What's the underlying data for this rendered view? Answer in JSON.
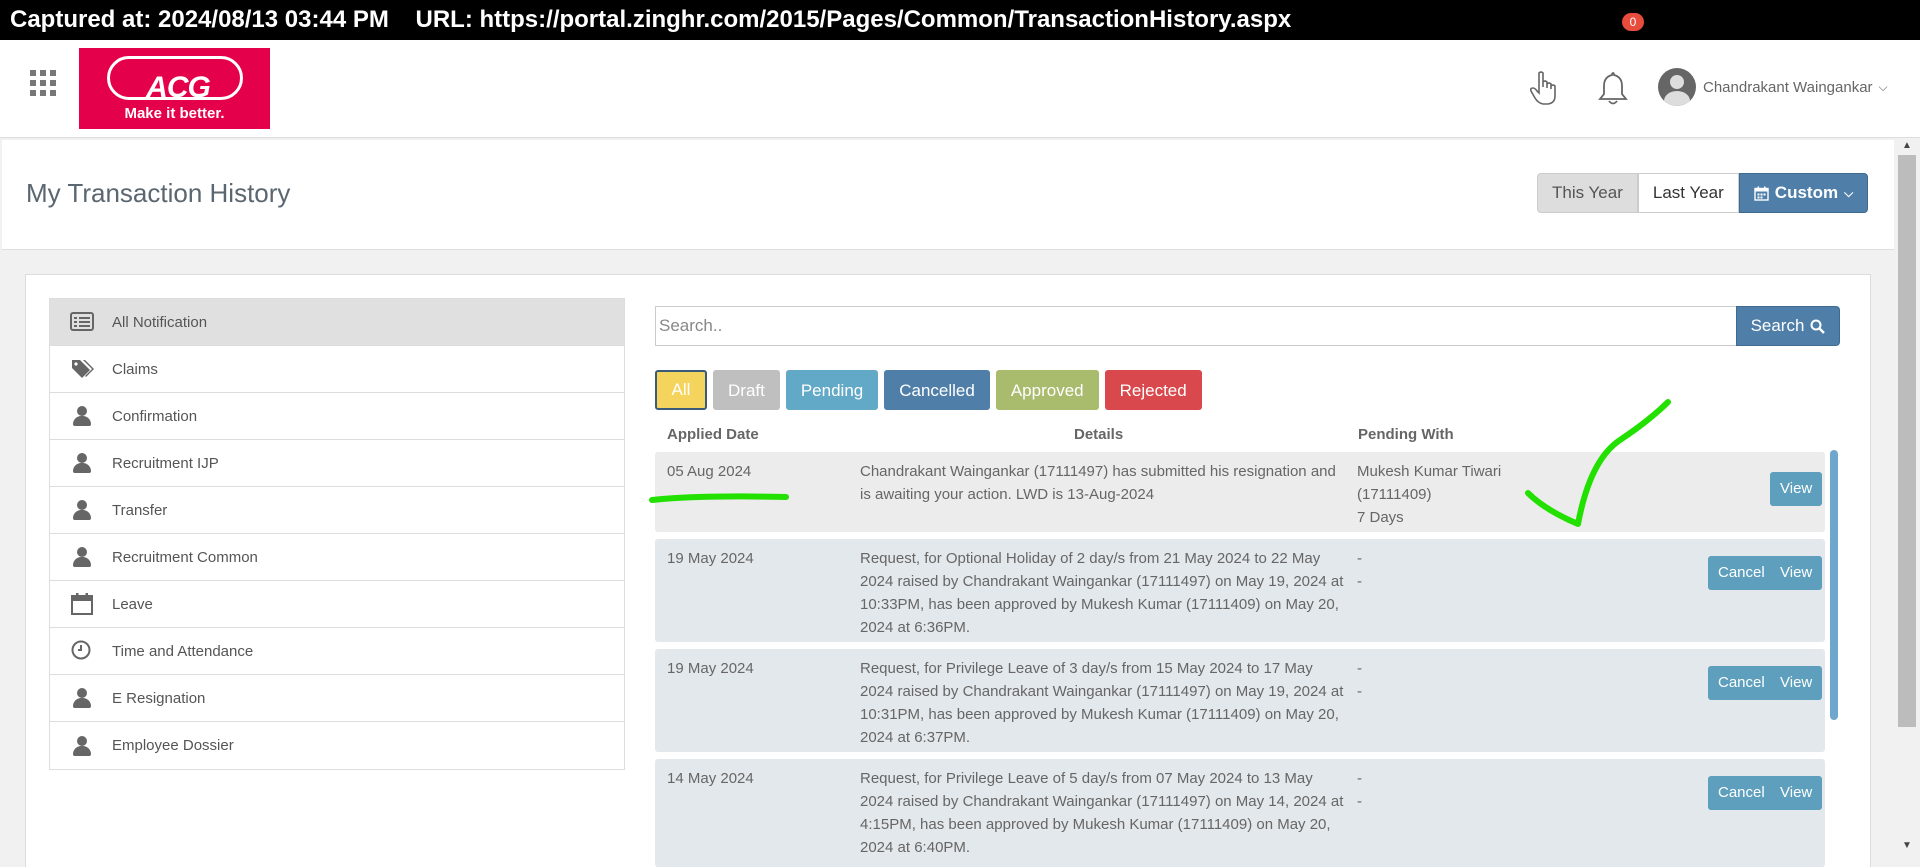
{
  "capture": {
    "text": "Captured at: 2024/08/13 03:44 PM    URL: https://portal.zinghr.com/2015/Pages/Common/TransactionHistory.aspx"
  },
  "header": {
    "logo_text": "ACG",
    "logo_tagline": "Make it better.",
    "notification_count": "0",
    "user_name": "Chandrakant Waingankar"
  },
  "page": {
    "title": "My Transaction History",
    "period_buttons": [
      "This Year",
      "Last Year",
      "Custom"
    ],
    "active_period": "This Year"
  },
  "sidebar": {
    "items": [
      {
        "label": "All Notification",
        "icon": "list-icon"
      },
      {
        "label": "Claims",
        "icon": "tags-icon"
      },
      {
        "label": "Confirmation",
        "icon": "person-icon"
      },
      {
        "label": "Recruitment IJP",
        "icon": "person-icon"
      },
      {
        "label": "Transfer",
        "icon": "person-icon"
      },
      {
        "label": "Recruitment Common",
        "icon": "person-icon"
      },
      {
        "label": "Leave",
        "icon": "calendar-icon"
      },
      {
        "label": "Time and Attendance",
        "icon": "clock-icon"
      },
      {
        "label": "E Resignation",
        "icon": "person-icon"
      },
      {
        "label": "Employee Dossier",
        "icon": "person-icon"
      }
    ],
    "active": "All Notification"
  },
  "search": {
    "placeholder": "Search..",
    "value": "",
    "button_label": "Search"
  },
  "filters": {
    "all": "All",
    "draft": "Draft",
    "pending": "Pending",
    "cancelled": "Cancelled",
    "approved": "Approved",
    "rejected": "Rejected",
    "active": "All"
  },
  "table": {
    "headers": {
      "applied_date": "Applied Date",
      "details": "Details",
      "pending_with": "Pending With"
    },
    "rows": [
      {
        "date": "05 Aug 2024",
        "details": "Chandrakant Waingankar (17111497) has submitted his resignation and is awaiting your action. LWD is 13-Aug-2024",
        "pending_line1": "Mukesh Kumar Tiwari",
        "pending_line2": "(17111409)",
        "pending_line3": "7 Days",
        "actions": [
          "View"
        ]
      },
      {
        "date": "19 May 2024",
        "details": "Request, for Optional Holiday of 2 day/s from 21 May 2024 to 22 May 2024 raised by Chandrakant Waingankar (17111497) on May 19, 2024 at 10:33PM, has been approved by Mukesh Kumar (17111409) on May 20, 2024 at 6:36PM.",
        "pending_line1": "-",
        "pending_line2": "-",
        "actions": [
          "Cancel",
          "View"
        ]
      },
      {
        "date": "19 May 2024",
        "details": "Request, for Privilege Leave of 3 day/s from 15 May 2024 to 17 May 2024 raised by Chandrakant Waingankar (17111497) on May 19, 2024 at 10:31PM, has been approved by Mukesh Kumar (17111409) on May 20, 2024 at 6:37PM.",
        "pending_line1": "-",
        "pending_line2": "-",
        "actions": [
          "Cancel",
          "View"
        ]
      },
      {
        "date": "14 May 2024",
        "details": "Request, for Privilege Leave of 5 day/s from 07 May 2024 to 13 May 2024 raised by Chandrakant Waingankar (17111497) on May 14, 2024 at 4:15PM, has been approved by Mukesh Kumar (17111409) on May 20, 2024 at 6:40PM.",
        "pending_line1": "-",
        "pending_line2": "-",
        "actions": [
          "Cancel",
          "View"
        ]
      }
    ]
  },
  "colors": {
    "brand": "#e5004c",
    "primary_button": "#4f7fa8",
    "action_button": "#5d9fbd",
    "annotation": "#22e000"
  }
}
